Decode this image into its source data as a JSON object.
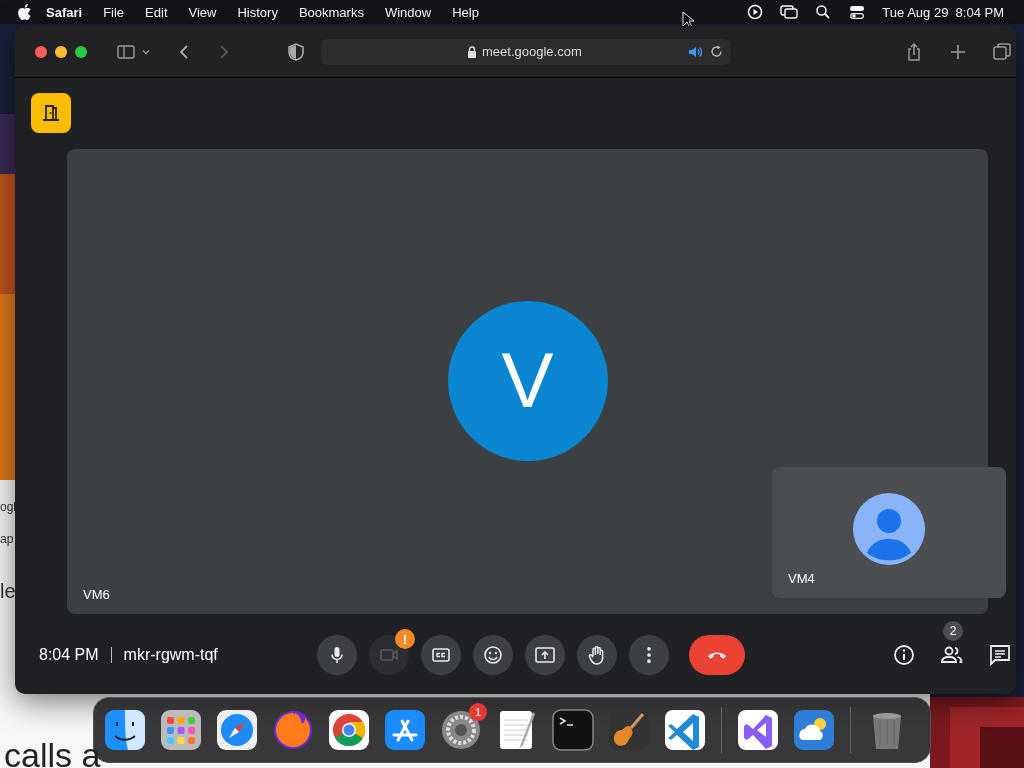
{
  "menubar": {
    "app_name": "Safari",
    "menus": [
      "File",
      "Edit",
      "View",
      "History",
      "Bookmarks",
      "Window",
      "Help"
    ],
    "clock": "Tue Aug 29  8:04 PM"
  },
  "background_window": {
    "texts": [
      "ogl",
      "ap",
      "le",
      "calls a"
    ]
  },
  "browser": {
    "url": "meet.google.com",
    "audio_playing": true,
    "meeting": {
      "main_participant": {
        "initial": "V",
        "name": "VM6"
      },
      "self_tile": {
        "name": "VM4"
      },
      "time": "8:04 PM",
      "code": "mkr-rgwm-tqf",
      "controls": [
        {
          "kind": "mic",
          "on": true
        },
        {
          "kind": "camera",
          "on": false,
          "badge": "!"
        },
        {
          "kind": "captions",
          "on": true
        },
        {
          "kind": "reactions",
          "on": true
        },
        {
          "kind": "present",
          "on": true
        },
        {
          "kind": "hand",
          "on": true
        },
        {
          "kind": "more",
          "on": true
        },
        {
          "kind": "hangup",
          "on": true
        }
      ],
      "side_buttons": [
        {
          "kind": "info"
        },
        {
          "kind": "people",
          "badge": "2"
        },
        {
          "kind": "chat"
        }
      ]
    }
  },
  "dock": {
    "groups": [
      [
        {
          "kind": "finder"
        },
        {
          "kind": "launchpad"
        },
        {
          "kind": "safari"
        },
        {
          "kind": "firefox"
        },
        {
          "kind": "chrome"
        },
        {
          "kind": "appstore"
        },
        {
          "kind": "settings",
          "badge": "1"
        },
        {
          "kind": "textedit"
        },
        {
          "kind": "terminal"
        },
        {
          "kind": "guitar"
        },
        {
          "kind": "vscode"
        }
      ],
      [
        {
          "kind": "visualstudio"
        },
        {
          "kind": "weather"
        }
      ],
      [
        {
          "kind": "trash"
        }
      ]
    ]
  }
}
